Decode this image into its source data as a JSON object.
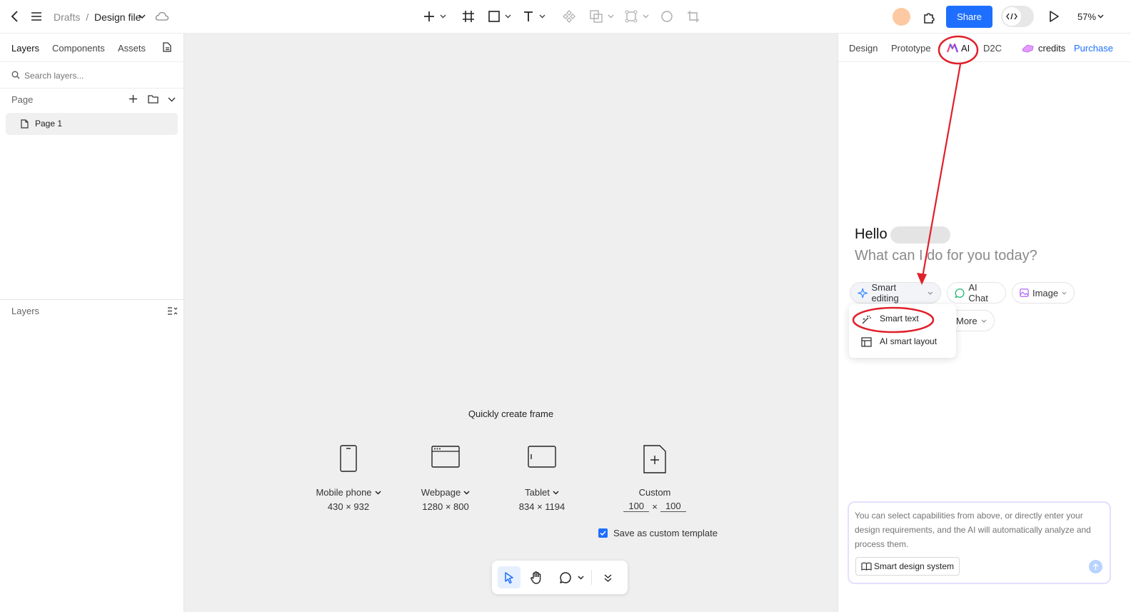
{
  "topbar": {
    "breadcrumb_parent": "Drafts",
    "breadcrumb_sep": "/",
    "file_name": "Design file",
    "share_label": "Share",
    "zoom": "57%"
  },
  "left": {
    "tabs": [
      "Layers",
      "Components",
      "Assets"
    ],
    "search_placeholder": "Search layers...",
    "page_section": "Page",
    "pages": [
      "Page 1"
    ],
    "layers_section": "Layers"
  },
  "canvas": {
    "quick_title": "Quickly create frame",
    "frames": [
      {
        "name": "Mobile phone",
        "size": "430 × 932"
      },
      {
        "name": "Webpage",
        "size": "1280 × 800"
      },
      {
        "name": "Tablet",
        "size": "834 × 1194"
      },
      {
        "name": "Custom",
        "w": "100",
        "x": "×",
        "h": "100"
      }
    ],
    "save_template": "Save as custom template",
    "save_checked": true
  },
  "right": {
    "tabs": [
      "Design",
      "Prototype",
      "AI",
      "D2C"
    ],
    "credits_label": "credits",
    "purchase_label": "Purchase",
    "hello": "Hello",
    "subtitle": "What can I do for you today?",
    "chips": [
      "Smart editing",
      "AI Chat",
      "Image",
      "More"
    ],
    "menu_items": [
      "Smart text",
      "AI smart layout"
    ],
    "input_placeholder": "You can select capabilities from above, or directly enter your design requirements, and the AI will automatically analyze and process them.",
    "design_system_label": "Smart design system"
  },
  "colors": {
    "accent": "#1e6fff",
    "annotation": "#e0202a",
    "canvas": "#efefef"
  }
}
